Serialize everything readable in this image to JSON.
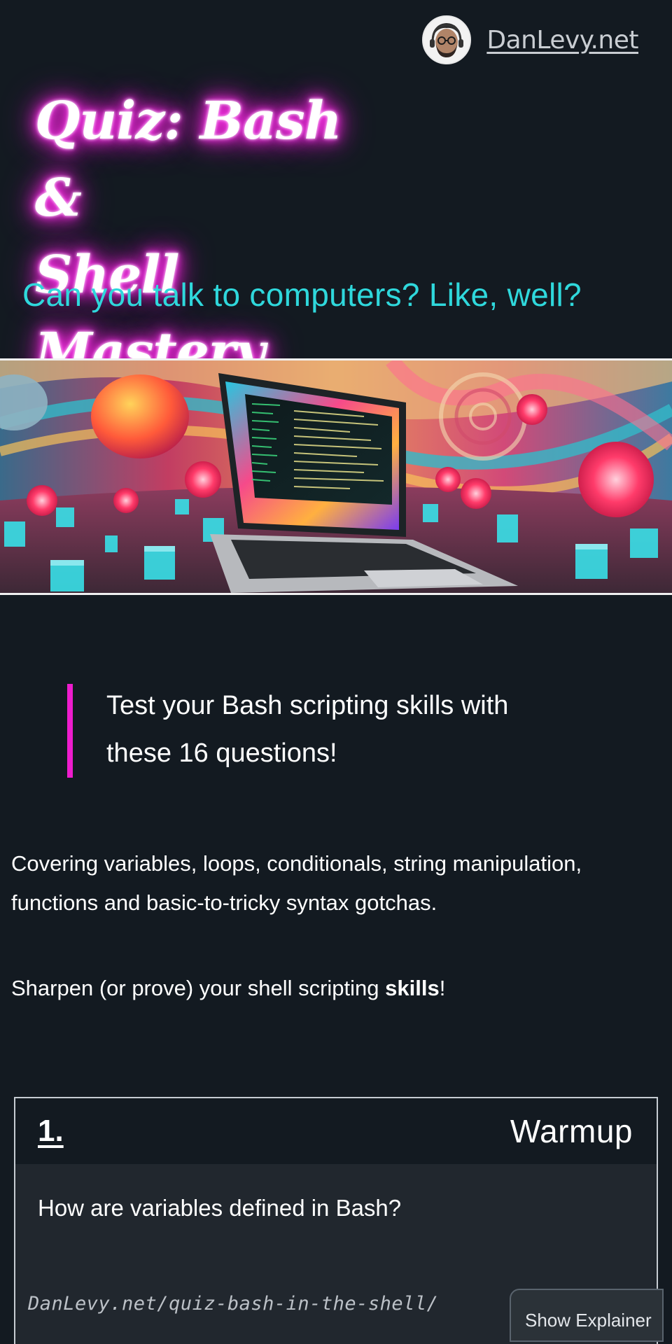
{
  "header": {
    "site_name": "DanLevy.net"
  },
  "hero": {
    "title_line1": "Quiz: Bash &",
    "title_line2": "Shell Mastery",
    "subtitle": "Can you talk to computers? Like, well?"
  },
  "intro": {
    "callout": "Test your Bash scripting skills with these 16 questions!",
    "paragraph1": "Covering variables, loops, conditionals, string manipulation, functions and basic-to-tricky syntax gotchas.",
    "paragraph2_before": "Sharpen (or prove) your shell scripting ",
    "paragraph2_bold": "skills",
    "paragraph2_after": "!"
  },
  "question": {
    "number": "1.",
    "category": "Warmup",
    "text": "How are variables defined in Bash?",
    "url": "DanLevy.net/quiz-bash-in-the-shell/",
    "explainer_label": "Show Explainer"
  },
  "colors": {
    "background": "#131a21",
    "subtitle": "#2fd8dc",
    "callout_border": "#ee1ccd",
    "title_glow": "#ff2ee6",
    "card_body": "#21272e"
  }
}
